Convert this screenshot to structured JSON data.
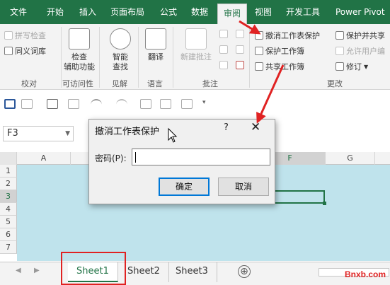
{
  "ribbon_tabs": [
    "文件",
    "开始",
    "插入",
    "页面布局",
    "公式",
    "数据",
    "审阅",
    "视图",
    "开发工具",
    "Power Pivot"
  ],
  "active_tab": "审阅",
  "groups": {
    "proofing": {
      "spell_check": "拼写检查",
      "thesaurus": "同义词库",
      "label": "校对"
    },
    "accessibility": {
      "check": "检查\n辅助功能",
      "label": "可访问性"
    },
    "insights": {
      "smart_lookup": "智能\n查找",
      "label": "见解"
    },
    "language": {
      "translate": "翻译",
      "label": "语言"
    },
    "comments": {
      "new_comment": "新建批注",
      "label": "批注"
    },
    "changes": {
      "unprotect_sheet": "撤消工作表保护",
      "protect_workbook": "保护工作簿",
      "share_workbook": "共享工作簿",
      "protect_and_share": "保护并共享",
      "allow_edit_ranges": "允许用户编",
      "track_changes": "修订",
      "label": "更改"
    }
  },
  "name_box": "F3",
  "columns": [
    "A",
    "F",
    "G"
  ],
  "rows": [
    "1",
    "2",
    "3",
    "4",
    "5",
    "6",
    "7"
  ],
  "dialog": {
    "title": "撤消工作表保护",
    "help": "?",
    "close": "✕",
    "password_label": "密码(P):",
    "ok": "确定",
    "cancel": "取消"
  },
  "sheets": [
    "Sheet1",
    "Sheet2",
    "Sheet3"
  ],
  "active_sheet": "Sheet1",
  "add_sheet": "⊕",
  "watermark": "Bnxb.com",
  "colors": {
    "excel_green": "#217346",
    "highlight_red": "#e02222",
    "cell_fill": "#bfe3ec"
  }
}
